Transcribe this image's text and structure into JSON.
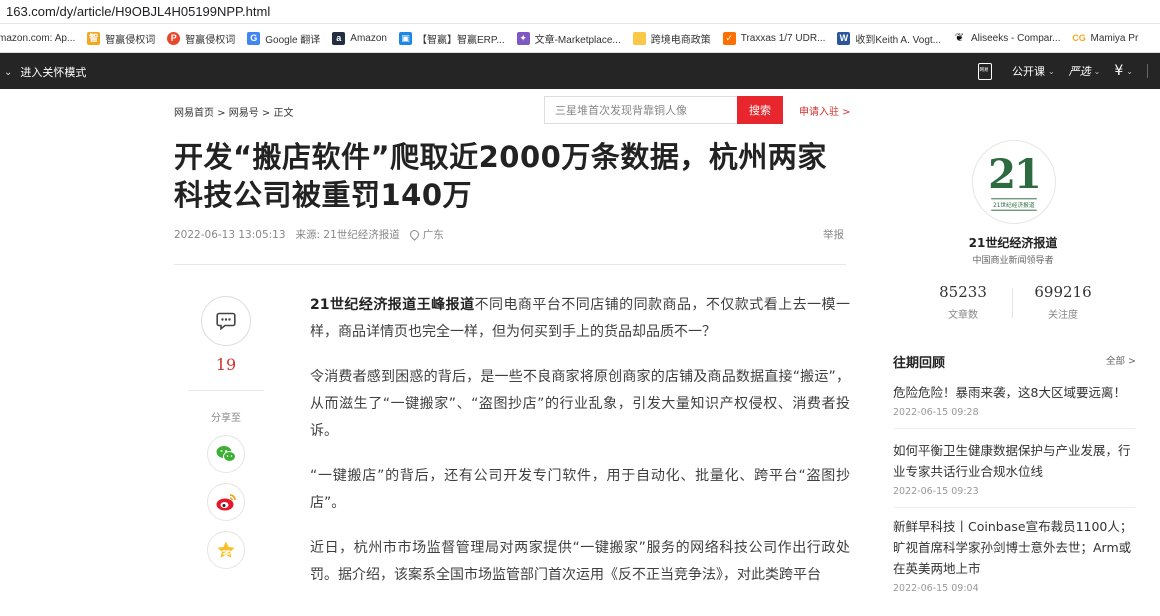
{
  "browser": {
    "url": "163.com/dy/article/H9OBJL4H05199NPP.html",
    "bookmarks": [
      {
        "label": "mazon.com: Ap...",
        "icon": "amazon-icon",
        "color": "#ff9900"
      },
      {
        "label": "智赢侵权词",
        "icon": "zhiying-icon",
        "color": "#f5a623"
      },
      {
        "label": "智赢侵权词",
        "icon": "zhiying-red-icon",
        "color": "#e8472c"
      },
      {
        "label": "Google 翻译",
        "icon": "google-translate-icon",
        "color": "#4285f4"
      },
      {
        "label": "Amazon",
        "icon": "amazon-a-icon",
        "color": "#232f3e"
      },
      {
        "label": "【智赢】智赢ERP...",
        "icon": "erp-icon",
        "color": "#1e88e5"
      },
      {
        "label": "文章-Marketplace...",
        "icon": "marketplace-icon",
        "color": "#7e57c2"
      },
      {
        "label": "跨境电商政策",
        "icon": "folder-icon",
        "color": "#f9c846"
      },
      {
        "label": "Traxxas 1/7 UDR...",
        "icon": "traxxas-icon",
        "color": "#ff6f00"
      },
      {
        "label": "收到Keith A. Vogt...",
        "icon": "word-icon",
        "color": "#2b579a"
      },
      {
        "label": "Aliseeks - Compar...",
        "icon": "aliseeks-icon",
        "color": "#111111"
      },
      {
        "label": "Mamiya Pr",
        "icon": "mamiya-icon",
        "color": "#f5a623"
      }
    ]
  },
  "header": {
    "left_label": "进入关怀模式",
    "items": [
      "网易",
      "公开课",
      "严选",
      "¥"
    ]
  },
  "breadcrumb": "网易首页 > 网易号 > 正文",
  "search": {
    "placeholder": "三星堆首次发现背靠铜人像",
    "button": "搜索"
  },
  "apply_link": "申请入驻 >",
  "article": {
    "title": "开发“搬店软件”爬取近2000万条数据，杭州两家科技公司被重罚140万",
    "date": "2022-06-13 13:05:13",
    "source": "来源: 21世纪经济报道",
    "location": "广东",
    "report": "举报",
    "comment_count": "19",
    "share_label": "分享至",
    "lead": "21世纪经济报道王峰报道",
    "paragraphs": [
      "不同电商平台不同店铺的同款商品，不仅款式看上去一模一样，商品详情页也完全一样，但为何买到手上的货品却品质不一？",
      "令消费者感到困惑的背后，是一些不良商家将原创商家的店铺及商品数据直接“搬运”，从而滋生了“一键搬家”、“盗图抄店”的行业乱象，引发大量知识产权侵权、消费者投诉。",
      "“一键搬店”的背后，还有公司开发专门软件，用于自动化、批量化、跨平台“盗图抄店”。",
      "近日，杭州市市场监督管理局对两家提供“一键搬家”服务的网络科技公司作出行政处罚。据介绍，该案系全国市场监管部门首次运用《反不正当竞争法》，对此类跨平台"
    ]
  },
  "sidebar": {
    "logo_number": "21",
    "logo_sub": "21世纪经济报道",
    "name": "21世纪经济报道",
    "desc": "中国商业新闻领导者",
    "stats": [
      {
        "value": "85233",
        "label": "文章数"
      },
      {
        "value": "699216",
        "label": "关注度"
      }
    ],
    "past_title": "往期回顾",
    "past_all": "全部 >",
    "news": [
      {
        "title": "危险危险！暴雨来袭，这8大区域要远离！",
        "date": "2022-06-15 09:28"
      },
      {
        "title": "如何平衡卫生健康数据保护与产业发展，行业专家共话行业合规水位线",
        "date": "2022-06-15 09:23"
      },
      {
        "title": "新鲜早科技丨Coinbase宣布裁员1100人；旷视首席科学家孙剑博士意外去世；Arm或在英美两地上市",
        "date": "2022-06-15 09:04"
      }
    ]
  }
}
